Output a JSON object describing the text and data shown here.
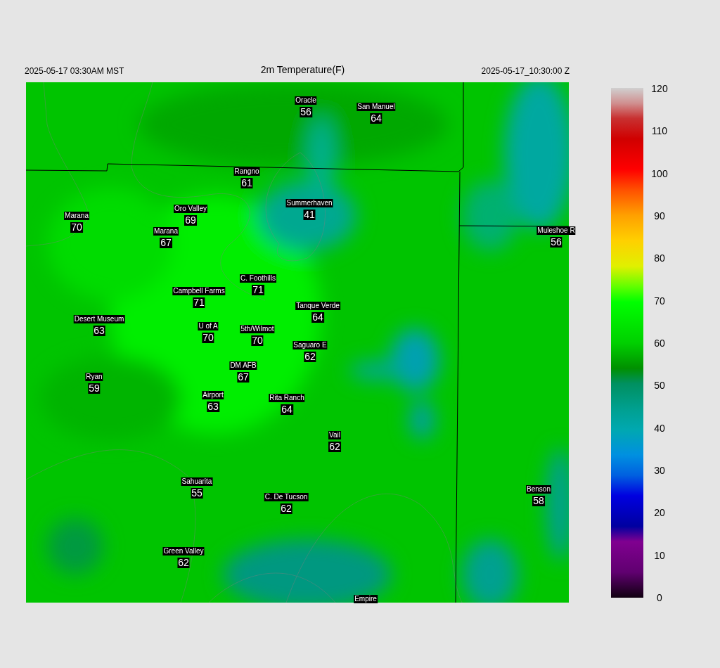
{
  "header": {
    "local_time": "2025-05-17 03:30AM MST",
    "title": "2m Temperature(F)",
    "utc_time": "2025-05-17_10:30:00 Z"
  },
  "stations": [
    {
      "name": "Oracle",
      "value": "56"
    },
    {
      "name": "San Manuel",
      "value": "64"
    },
    {
      "name": "Rangno",
      "value": "61"
    },
    {
      "name": "Summerhaven",
      "value": "41"
    },
    {
      "name": "Marana",
      "value": "70"
    },
    {
      "name": "Oro Valley",
      "value": "69"
    },
    {
      "name": "Marana",
      "value": "67"
    },
    {
      "name": "Muleshoe R",
      "value": "56"
    },
    {
      "name": "C. Foothills",
      "value": "71"
    },
    {
      "name": "Campbell Farms",
      "value": "71"
    },
    {
      "name": "Tanque Verde",
      "value": "64"
    },
    {
      "name": "Desert Museum",
      "value": "63"
    },
    {
      "name": "U of A",
      "value": "70"
    },
    {
      "name": "5th/Wilmot",
      "value": "70"
    },
    {
      "name": "Saguaro E",
      "value": "62"
    },
    {
      "name": "DM AFB",
      "value": "67"
    },
    {
      "name": "Ryan",
      "value": "59"
    },
    {
      "name": "Airport",
      "value": "63"
    },
    {
      "name": "Rita Ranch",
      "value": "64"
    },
    {
      "name": "Vail",
      "value": "62"
    },
    {
      "name": "Sahuarita",
      "value": "55"
    },
    {
      "name": "C. De Tucson",
      "value": "62"
    },
    {
      "name": "Benson",
      "value": "58"
    },
    {
      "name": "Green Valley",
      "value": "62"
    },
    {
      "name": "Empire"
    }
  ],
  "colorbar": {
    "ticks": [
      "120",
      "110",
      "100",
      "90",
      "80",
      "70",
      "60",
      "50",
      "40",
      "30",
      "20",
      "10",
      "0"
    ]
  }
}
